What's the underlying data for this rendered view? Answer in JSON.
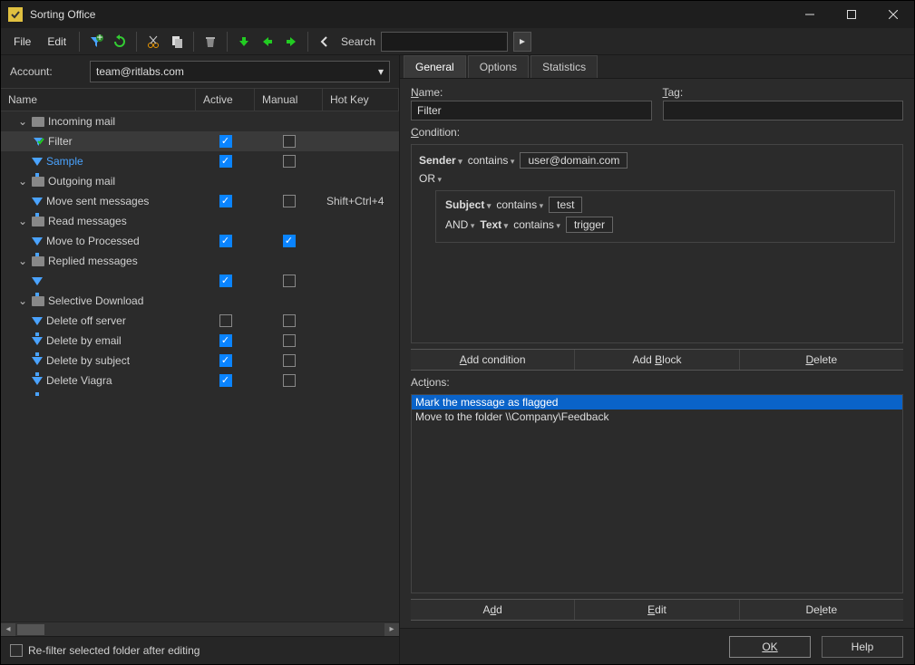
{
  "window": {
    "title": "Sorting Office"
  },
  "menu": {
    "file": "File",
    "edit": "Edit",
    "search_label": "Search",
    "search_value": ""
  },
  "account": {
    "label": "Account:",
    "value": "team@ritlabs.com"
  },
  "columns": {
    "name": "Name",
    "active": "Active",
    "manual": "Manual",
    "hotkey": "Hot Key"
  },
  "tree": [
    {
      "type": "group",
      "label": "Incoming mail",
      "expanded": true
    },
    {
      "type": "rule",
      "label": "Filter",
      "indent": 2,
      "active": true,
      "manual": false,
      "selected": true,
      "icon": "filter-green"
    },
    {
      "type": "rule",
      "label": "Sample",
      "indent": 2,
      "active": true,
      "manual": false,
      "link": true,
      "icon": "funnel"
    },
    {
      "type": "group",
      "label": "Outgoing mail",
      "expanded": true
    },
    {
      "type": "rule",
      "label": "Move sent messages",
      "indent": 2,
      "active": true,
      "manual": false,
      "hotkey": "Shift+Ctrl+4",
      "icon": "funnel"
    },
    {
      "type": "group",
      "label": "Read messages",
      "expanded": true
    },
    {
      "type": "rule",
      "label": "Move to Processed",
      "indent": 2,
      "active": true,
      "manual": true,
      "icon": "funnel"
    },
    {
      "type": "group",
      "label": "Replied messages",
      "expanded": true
    },
    {
      "type": "rule",
      "label": "",
      "indent": 2,
      "active": true,
      "manual": false,
      "icon": "funnel"
    },
    {
      "type": "group",
      "label": "Selective Download",
      "expanded": true
    },
    {
      "type": "rule",
      "label": "Delete off server",
      "indent": 2,
      "active": false,
      "manual": false,
      "icon": "funnel"
    },
    {
      "type": "rule",
      "label": "Delete by email",
      "indent": 2,
      "active": true,
      "manual": false,
      "icon": "funnel"
    },
    {
      "type": "rule",
      "label": "Delete by subject",
      "indent": 2,
      "active": true,
      "manual": false,
      "icon": "funnel"
    },
    {
      "type": "rule",
      "label": "Delete Viagra",
      "indent": 2,
      "active": true,
      "manual": false,
      "icon": "funnel"
    }
  ],
  "refilter_label": "Re-filter selected folder after editing",
  "refilter_checked": false,
  "tabs": {
    "general": "General",
    "options": "Options",
    "statistics": "Statistics"
  },
  "form": {
    "name_label": "Name:",
    "name_value": "Filter",
    "tag_label": "Tag:",
    "tag_value": "",
    "condition_label": "Condition:",
    "cond": {
      "field1": "Sender",
      "op1": "contains",
      "val1": "user@domain.com",
      "combiner1": "OR",
      "field2": "Subject",
      "op2": "contains",
      "val2": "test",
      "combiner2": "AND",
      "field3": "Text",
      "op3": "contains",
      "val3": "trigger"
    },
    "btn_addcond": "Add condition",
    "btn_addblock": "Add Block",
    "btn_delcond": "Delete",
    "actions_label": "Actions:",
    "actions": [
      {
        "text": "Mark the message as flagged",
        "selected": true
      },
      {
        "text": "Move to the folder \\\\Company\\Feedback",
        "selected": false
      }
    ],
    "btn_add": "Add",
    "btn_edit": "Edit",
    "btn_del": "Delete"
  },
  "footer": {
    "ok": "OK",
    "help": "Help"
  }
}
